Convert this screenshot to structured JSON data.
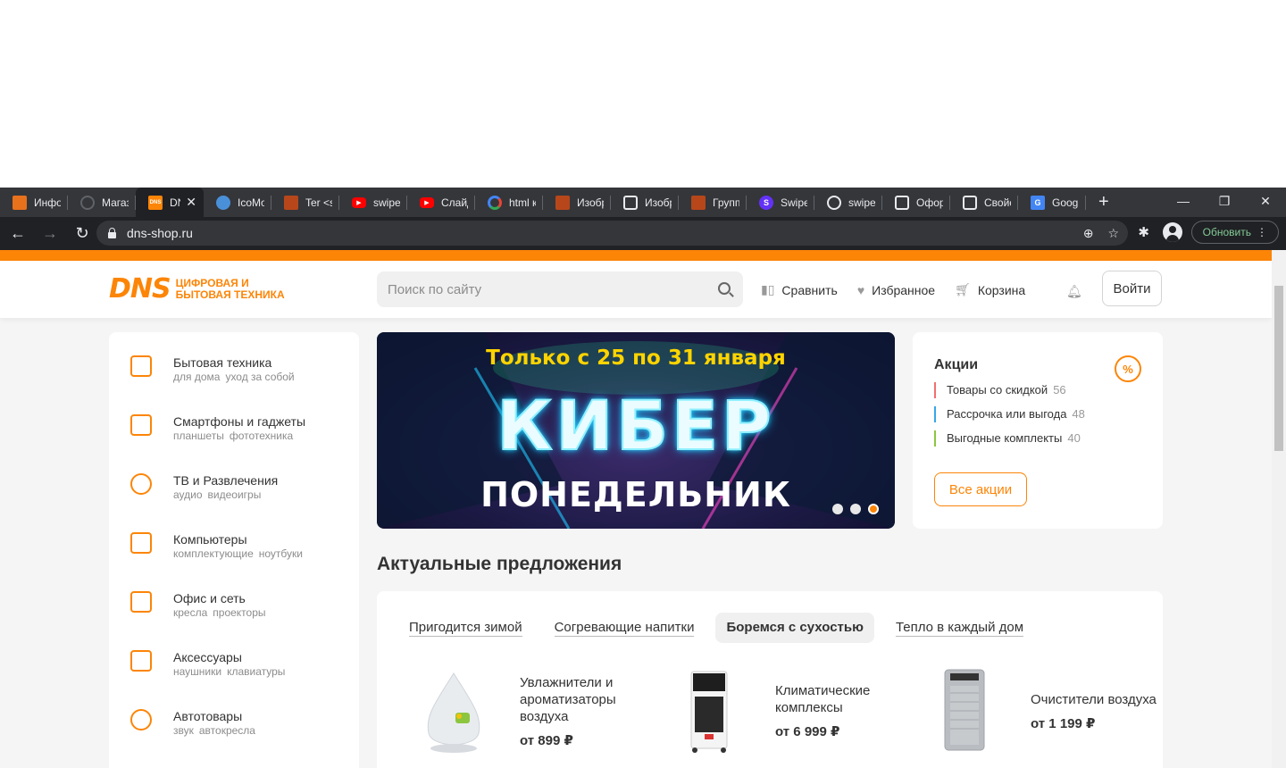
{
  "browser": {
    "tabs": [
      {
        "title": "Инфор",
        "icon": "orange-chart-icon",
        "color": "#e8711c"
      },
      {
        "title": "Магаз",
        "icon": "globe-grey-icon",
        "color": "#5f6368"
      },
      {
        "title": "DNS",
        "icon": "dns-logo-icon",
        "color": "#fc8507",
        "active": true
      },
      {
        "title": "IcoMo",
        "icon": "globe-blue-icon",
        "color": "#4a90d9"
      },
      {
        "title": "Ter <s",
        "icon": "bricks-icon",
        "color": "#b7471a"
      },
      {
        "title": "swiper",
        "icon": "youtube-icon",
        "color": "#ff0000"
      },
      {
        "title": "Слайд",
        "icon": "youtube-icon",
        "color": "#ff0000"
      },
      {
        "title": "html к",
        "icon": "google-icon",
        "color": "#4285f4"
      },
      {
        "title": "Изобр",
        "icon": "bricks-icon",
        "color": "#b7471a"
      },
      {
        "title": "Изобр",
        "icon": "shield-icon",
        "color": "#e8eaed"
      },
      {
        "title": "Групп",
        "icon": "bricks-icon",
        "color": "#b7471a"
      },
      {
        "title": "Swipe",
        "icon": "swiper-icon",
        "color": "#6332f6"
      },
      {
        "title": "swiper",
        "icon": "github-icon",
        "color": "#e8eaed"
      },
      {
        "title": "Оформ",
        "icon": "chat-icon",
        "color": "#e8eaed"
      },
      {
        "title": "Свойс",
        "icon": "shield-icon",
        "color": "#e8eaed"
      },
      {
        "title": "Googl",
        "icon": "translate-icon",
        "color": "#4285f4"
      }
    ],
    "active_close": "✕",
    "new_tab": "+",
    "window_controls": {
      "minimize": "—",
      "restore": "❐",
      "close": "✕"
    },
    "url": "dns-shop.ru",
    "update_label": "Обновить"
  },
  "site": {
    "logo": {
      "brand": "DNS",
      "line1": "Цифровая и",
      "line2": "бытовая техника"
    },
    "search_placeholder": "Поиск по сайту",
    "links": {
      "compare": "Сравнить",
      "favorites": "Избранное",
      "cart": "Корзина"
    },
    "login": "Войти",
    "accent": "#fc8507",
    "categories": [
      {
        "title": "Бытовая техника",
        "subs": [
          "для дома",
          "уход за собой"
        ],
        "icon": "washer-icon"
      },
      {
        "title": "Смартфоны и гаджеты",
        "subs": [
          "планшеты",
          "фототехника"
        ],
        "icon": "smartphone-icon"
      },
      {
        "title": "ТВ и Развлечения",
        "subs": [
          "аудио",
          "видеоигры"
        ],
        "icon": "tv-icon"
      },
      {
        "title": "Компьютеры",
        "subs": [
          "комплектующие",
          "ноутбуки"
        ],
        "icon": "computer-icon"
      },
      {
        "title": "Офис и сеть",
        "subs": [
          "кресла",
          "проекторы"
        ],
        "icon": "printer-icon"
      },
      {
        "title": "Аксессуары",
        "subs": [
          "наушники",
          "клавиатуры"
        ],
        "icon": "cable-icon"
      },
      {
        "title": "Автотовары",
        "subs": [
          "звук",
          "автокресла"
        ],
        "icon": "steering-wheel-icon"
      }
    ],
    "banner": {
      "top": "Только с 25 по 31 января",
      "big": "КИБЕР",
      "sub": "ПОНЕДЕЛЬНИК",
      "slides": 3,
      "active_slide": 3
    },
    "promo": {
      "title": "Акции",
      "icon_text": "%",
      "items": [
        {
          "label": "Товары со скидкой",
          "count": "56",
          "color": "#f26f6f"
        },
        {
          "label": "Рассрочка или выгода",
          "count": "48",
          "color": "#37a7e8"
        },
        {
          "label": "Выгодные комплекты",
          "count": "40",
          "color": "#8cc63f"
        }
      ],
      "button": "Все акции"
    },
    "offers": {
      "title": "Актуальные предложения",
      "tabs": [
        "Пригодится зимой",
        "Согревающие напитки",
        "Боремся с сухостью",
        "Тепло в каждый дом"
      ],
      "active_tab": 2,
      "products": [
        {
          "name": "Увлажнители и ароматизаторы воздуха",
          "price": "от 899 ₽"
        },
        {
          "name": "Климатические комплексы",
          "price": "от 6 999 ₽"
        },
        {
          "name": "Очистители воздуха",
          "price": "от 1 199 ₽"
        }
      ]
    }
  }
}
